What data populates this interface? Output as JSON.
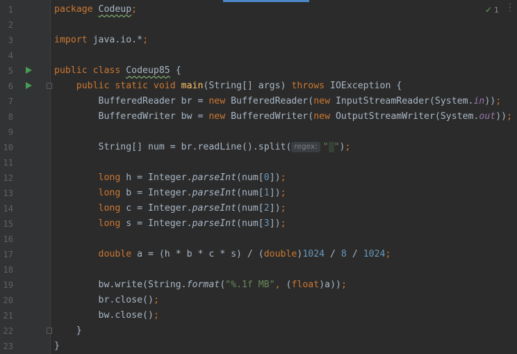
{
  "status": {
    "problems_count": "1",
    "check_icon": "check-icon"
  },
  "line_numbers": [
    "1",
    "2",
    "3",
    "4",
    "5",
    "6",
    "7",
    "8",
    "9",
    "10",
    "11",
    "12",
    "13",
    "14",
    "15",
    "16",
    "17",
    "18",
    "19",
    "20",
    "21",
    "22",
    "23"
  ],
  "code": {
    "l1_kw": "package",
    "l1_pkg": "Codeup",
    "l1_semi": ";",
    "l3_kw": "import",
    "l3_pkg": "java.io.*",
    "l3_semi": ";",
    "l5_kw": "public class",
    "l5_name": "Codeup85",
    "l5_rest": "{",
    "l6_kw": "public static void",
    "l6_name": "main",
    "l6_params": "(String[] args)",
    "l6_throws": "throws",
    "l6_rest": "IOException {",
    "l7_a": "BufferedReader br = ",
    "l7_new1": "new",
    "l7_b": " BufferedReader(",
    "l7_new2": "new",
    "l7_c": " InputStreamReader(System.",
    "l7_fld": "in",
    "l7_d": "))",
    "l7_semi": ";",
    "l8_a": "BufferedWriter bw = ",
    "l8_new1": "new",
    "l8_b": " BufferedWriter(",
    "l8_new2": "new",
    "l8_c": " OutputStreamWriter(System.",
    "l8_fld": "out",
    "l8_d": "))",
    "l8_semi": ";",
    "l10_a": "String[] num = br.readLine().split(",
    "l10_hint": "regex:",
    "l10_str_open": "\"",
    "l10_str_space": " ",
    "l10_str_close": "\"",
    "l10_b": ")",
    "l10_semi": ";",
    "l12_kw": "long",
    "l12_a": " h = Integer.",
    "l12_m": "parseInt",
    "l12_b": "(num[",
    "l12_n": "0",
    "l12_c": "])",
    "l12_semi": ";",
    "l13_kw": "long",
    "l13_a": " b = Integer.",
    "l13_m": "parseInt",
    "l13_b": "(num[",
    "l13_n": "1",
    "l13_c": "])",
    "l13_semi": ";",
    "l14_kw": "long",
    "l14_a": " c = Integer.",
    "l14_m": "parseInt",
    "l14_b": "(num[",
    "l14_n": "2",
    "l14_c": "])",
    "l14_semi": ";",
    "l15_kw": "long",
    "l15_a": " s = Integer.",
    "l15_m": "parseInt",
    "l15_b": "(num[",
    "l15_n": "3",
    "l15_c": "])",
    "l15_semi": ";",
    "l17_kw": "double",
    "l17_a": " a = (h * b * c * s) / (",
    "l17_kw2": "double",
    "l17_b": ")",
    "l17_n1": "1024",
    "l17_op1": " / ",
    "l17_n2": "8",
    "l17_op2": " / ",
    "l17_n3": "1024",
    "l17_semi": ";",
    "l19_a": "bw.write(String.",
    "l19_m": "format",
    "l19_b": "(",
    "l19_str": "\"%.1f MB\"",
    "l19_comma": ", ",
    "l19_c": "(",
    "l19_kw": "float",
    "l19_d": ")a))",
    "l19_semi": ";",
    "l20_a": "br.close()",
    "l20_semi": ";",
    "l21_a": "bw.close()",
    "l21_semi": ";",
    "l22": "}",
    "l23": "}"
  }
}
